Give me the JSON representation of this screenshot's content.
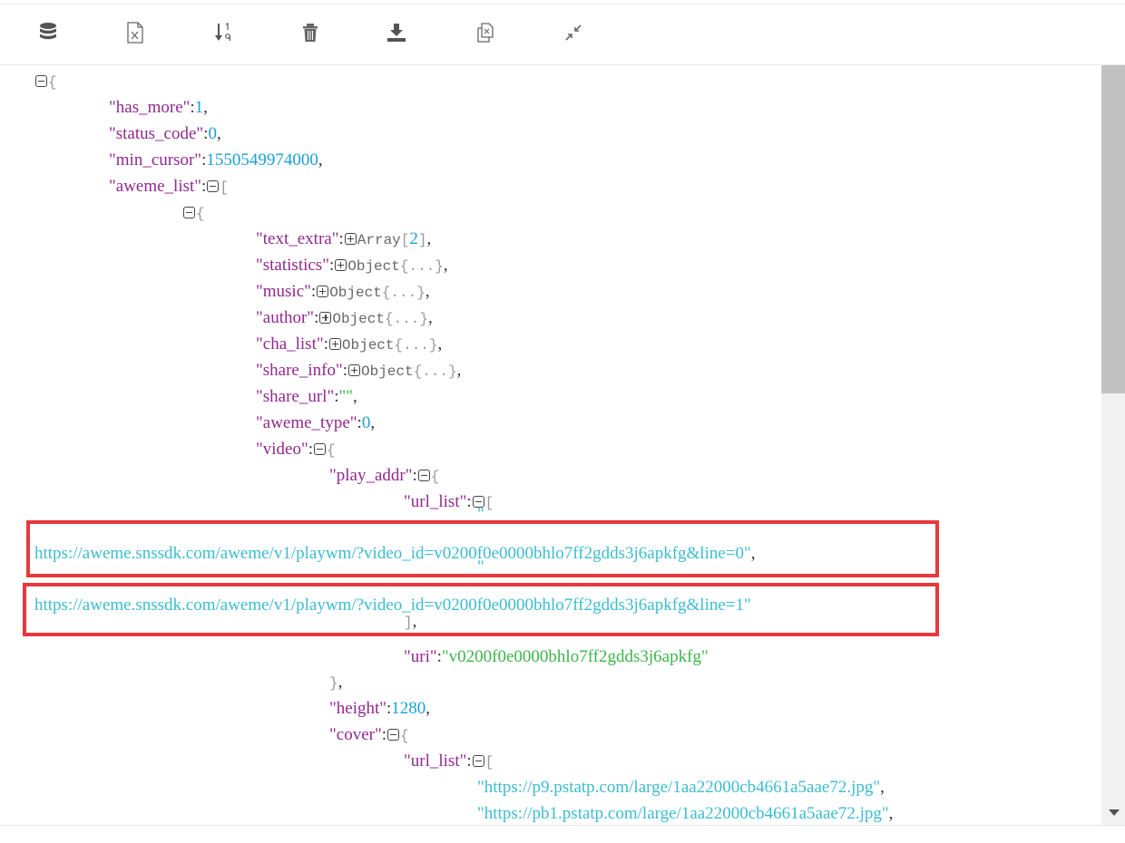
{
  "toolbar": {
    "icons": [
      "database-icon",
      "excel-export-icon",
      "sort-icon",
      "delete-icon",
      "download-icon",
      "copy-icon",
      "collapse-icon"
    ]
  },
  "json": {
    "open_brace": "{",
    "close_brace": "}",
    "open_bracket": "[",
    "close_bracket": "]",
    "colon": ":",
    "comma": ",",
    "has_more": {
      "key": "\"has_more\"",
      "value": "1"
    },
    "status_code": {
      "key": "\"status_code\"",
      "value": "0"
    },
    "min_cursor": {
      "key": "\"min_cursor\"",
      "value": "1550549974000"
    },
    "aweme_list": {
      "key": "\"aweme_list\""
    },
    "text_extra": {
      "key": "\"text_extra\"",
      "type": "Array",
      "count": "2"
    },
    "statistics": {
      "key": "\"statistics\"",
      "type": "Object",
      "ellipsis": "{...}"
    },
    "music": {
      "key": "\"music\"",
      "type": "Object",
      "ellipsis": "{...}"
    },
    "author": {
      "key": "\"author\"",
      "type": "Object",
      "ellipsis": "{...}"
    },
    "cha_list": {
      "key": "\"cha_list\"",
      "type": "Object",
      "ellipsis": "{...}"
    },
    "share_info": {
      "key": "\"share_info\"",
      "type": "Object",
      "ellipsis": "{...}"
    },
    "share_url": {
      "key": "\"share_url\"",
      "value": "\"\""
    },
    "aweme_type": {
      "key": "\"aweme_type\"",
      "value": "0"
    },
    "video": {
      "key": "\"video\""
    },
    "play_addr": {
      "key": "\"play_addr\""
    },
    "url_list": {
      "key": "\"url_list\""
    },
    "url_quote": "\"",
    "url_0": "https://aweme.snssdk.com/aweme/v1/playwm/?video_id=v0200f0e0000bhlo7ff2gdds3j6apkfg&line=0\"",
    "url_1": "https://aweme.snssdk.com/aweme/v1/playwm/?video_id=v0200f0e0000bhlo7ff2gdds3j6apkfg&line=1\"",
    "uri": {
      "key": "\"uri\"",
      "value": "\"v0200f0e0000bhlo7ff2gdds3j6apkfg\""
    },
    "height": {
      "key": "\"height\"",
      "value": "1280"
    },
    "cover": {
      "key": "\"cover\""
    },
    "cover_url_0": "\"https://p9.pstatp.com/large/1aa22000cb4661a5aae72.jpg\"",
    "cover_url_1": "\"https://pb1.pstatp.com/large/1aa22000cb4661a5aae72.jpg\""
  }
}
